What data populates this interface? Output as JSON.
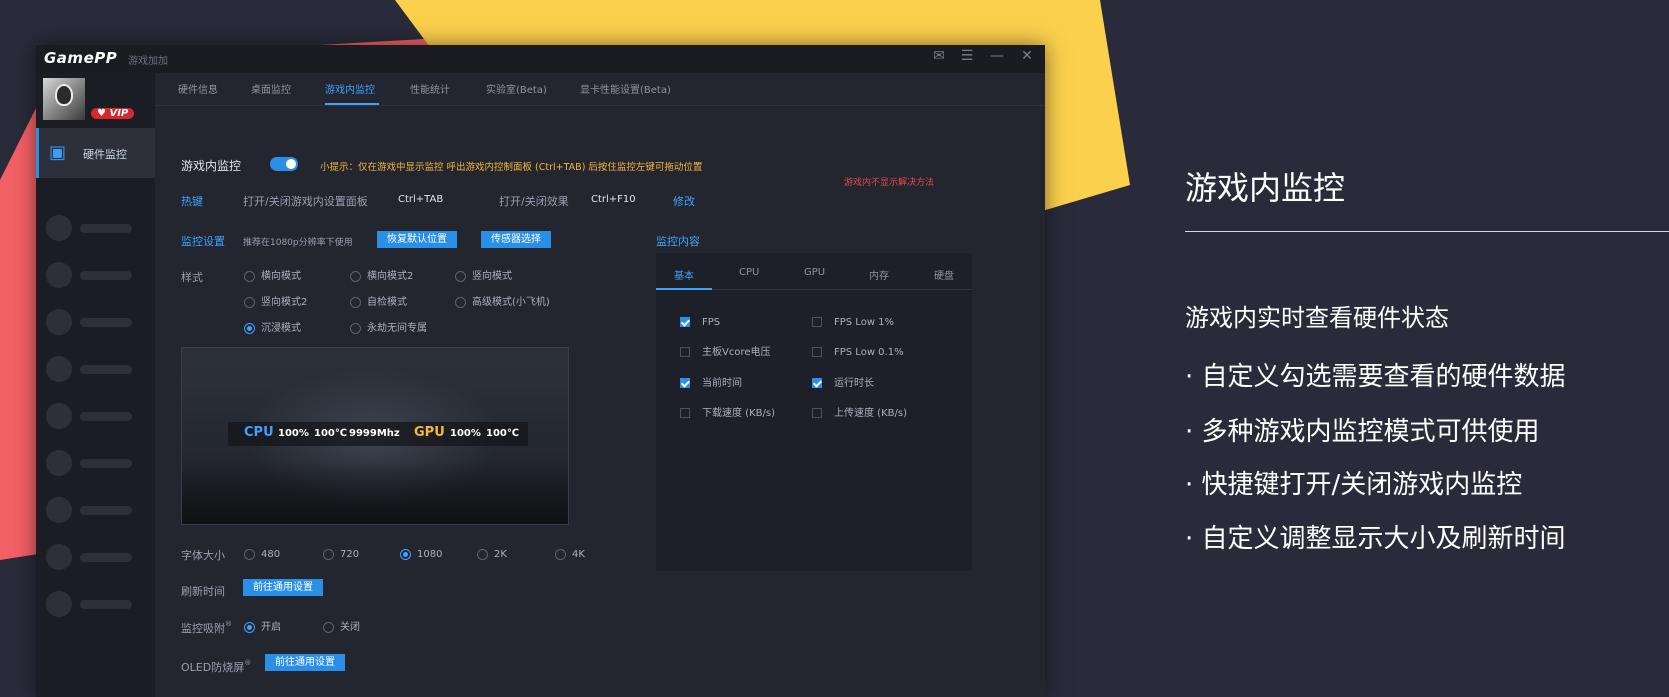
{
  "colors": {
    "background": "#2a2b3a",
    "accent": "#2a8fe6",
    "shape_red": "#f26164",
    "shape_yellow": "#fbd04c"
  },
  "app": {
    "logo": "GamePP",
    "subtitle": "游戏加加",
    "window_controls": [
      "✉",
      "☰",
      "—",
      "✕"
    ],
    "vip": "VIP",
    "sidebar_active": "硬件监控",
    "tabs": [
      "硬件信息",
      "桌面监控",
      "游戏内监控",
      "性能统计",
      "实验室(Beta)",
      "显卡性能设置(Beta)"
    ],
    "ingame": {
      "label": "游戏内监控",
      "tip": "小提示：仅在游戏中显示监控 呼出游戏内控制面板 (Ctrl+TAB) 后按住监控左键可拖动位置",
      "not_shown": "游戏内不显示解决方法"
    },
    "hotkey": {
      "label": "热键",
      "open_settings": "打开/关闭游戏内设置面板",
      "open_settings_key": "Ctrl+TAB",
      "toggle_effect": "打开/关闭效果",
      "toggle_effect_key": "Ctrl+F10",
      "modify": "修改"
    },
    "monitor_settings": {
      "label": "监控设置",
      "hint": "推荐在1080p分辨率下使用",
      "reset_button": "恢复默认位置",
      "sensor_button": "传感器选择"
    },
    "style": {
      "label": "样式",
      "options": [
        "横向模式",
        "横向模式2",
        "竖向模式",
        "竖向模式2",
        "自检模式",
        "高级模式(小飞机)",
        "沉浸模式",
        "永劫无间专属"
      ],
      "selected": "沉浸模式"
    },
    "preview": {
      "cpu_label": "CPU",
      "cpu_usage": "100%",
      "cpu_temp": "100℃",
      "cpu_freq": "9999Mhz",
      "gpu_label": "GPU",
      "gpu_usage": "100%",
      "gpu_temp": "100℃"
    },
    "font_size": {
      "label": "字体大小",
      "options": [
        "480",
        "720",
        "1080",
        "2K",
        "4K"
      ],
      "selected": "1080"
    },
    "refresh": {
      "label": "刷新时间",
      "button": "前往通用设置"
    },
    "snap": {
      "label": "监控吸附",
      "mark": "®",
      "on": "开启",
      "off": "关闭",
      "selected": "开启"
    },
    "oled": {
      "label": "OLED防烧屏",
      "mark": "®",
      "button": "前往通用设置"
    },
    "monitor_content": {
      "label": "监控内容",
      "tabs": [
        "基本",
        "CPU",
        "GPU",
        "内存",
        "硬盘"
      ],
      "items": [
        {
          "label": "FPS",
          "checked": true
        },
        {
          "label": "FPS Low 1%",
          "checked": false
        },
        {
          "label": "主板Vcore电压",
          "checked": false
        },
        {
          "label": "FPS Low 0.1%",
          "checked": false
        },
        {
          "label": "当前时间",
          "checked": true
        },
        {
          "label": "运行时长",
          "checked": true
        },
        {
          "label": "下载速度 (KB/s)",
          "checked": false
        },
        {
          "label": "上传速度 (KB/s)",
          "checked": false
        }
      ]
    }
  },
  "promo": {
    "title": "游戏内监控",
    "subtitle": "游戏内实时查看硬件状态",
    "bullets": [
      "· 自定义勾选需要查看的硬件数据",
      "· 多种游戏内监控模式可供使用",
      "· 快捷键打开/关闭游戏内监控",
      "· 自定义调整显示大小及刷新时间"
    ]
  }
}
